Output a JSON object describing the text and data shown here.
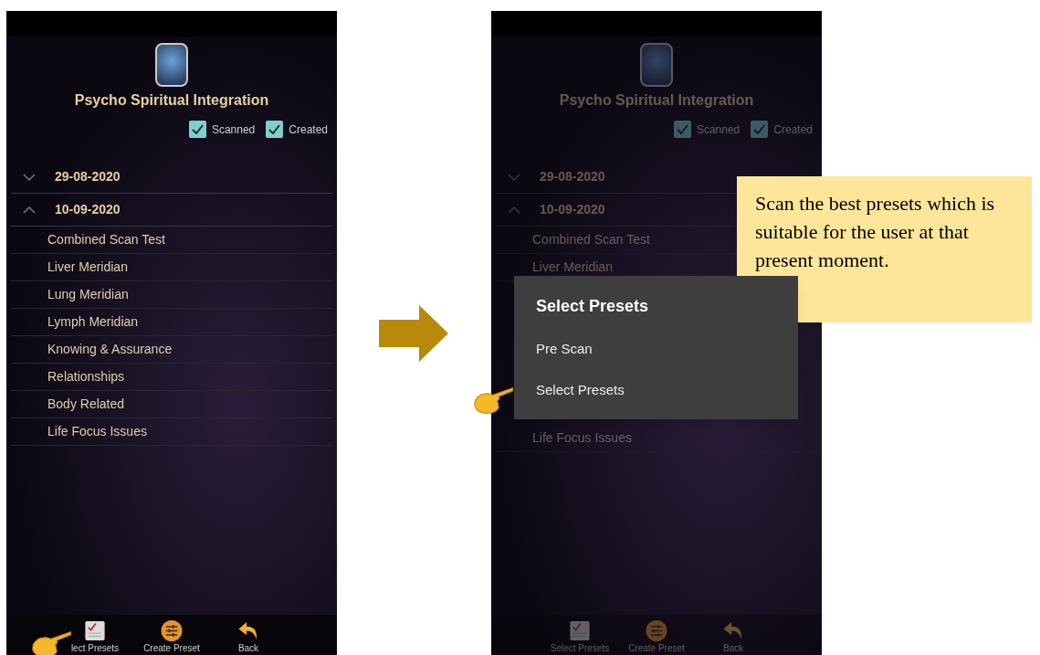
{
  "phones": [
    {
      "title": "Psycho Spiritual Integration",
      "dimmed": false,
      "filters": [
        {
          "label": "Scanned",
          "checked": true
        },
        {
          "label": "Created",
          "checked": true
        }
      ],
      "groups": [
        {
          "date": "29-08-2020",
          "expanded": false
        },
        {
          "date": "10-09-2020",
          "expanded": true,
          "children": [
            "Combined Scan Test",
            "Liver Meridian",
            "Lung Meridian",
            "Lymph Meridian",
            "Knowing & Assurance",
            "Relationships",
            "Body Related",
            "Life Focus Issues"
          ]
        }
      ],
      "nav": [
        {
          "kind": "checklist",
          "label": "lect Presets",
          "pointed": true
        },
        {
          "kind": "sliders",
          "label": "Create Preset",
          "pointed": false
        },
        {
          "kind": "back",
          "label": "Back",
          "pointed": false
        }
      ]
    },
    {
      "title": "Psycho Spiritual Integration",
      "dimmed": true,
      "filters": [
        {
          "label": "Scanned",
          "checked": true
        },
        {
          "label": "Created",
          "checked": true
        }
      ],
      "groups": [
        {
          "date": "29-08-2020",
          "expanded": false
        },
        {
          "date": "10-09-2020",
          "expanded": true,
          "children": [
            "Combined Scan Test",
            "Liver Meridian",
            "Life Focus Issues"
          ]
        }
      ],
      "nav": [
        {
          "kind": "checklist",
          "label": "Select Presets",
          "pointed": false
        },
        {
          "kind": "sliders",
          "label": "Create Preset",
          "pointed": false
        },
        {
          "kind": "back",
          "label": "Back",
          "pointed": false
        }
      ],
      "dialog": {
        "title": "Select Presets",
        "options": [
          {
            "label": "Pre Scan",
            "pointed": false
          },
          {
            "label": "Select Presets",
            "pointed": true
          }
        ]
      }
    }
  ],
  "callout": "Scan the best presets which is suitable for the user at that present moment."
}
